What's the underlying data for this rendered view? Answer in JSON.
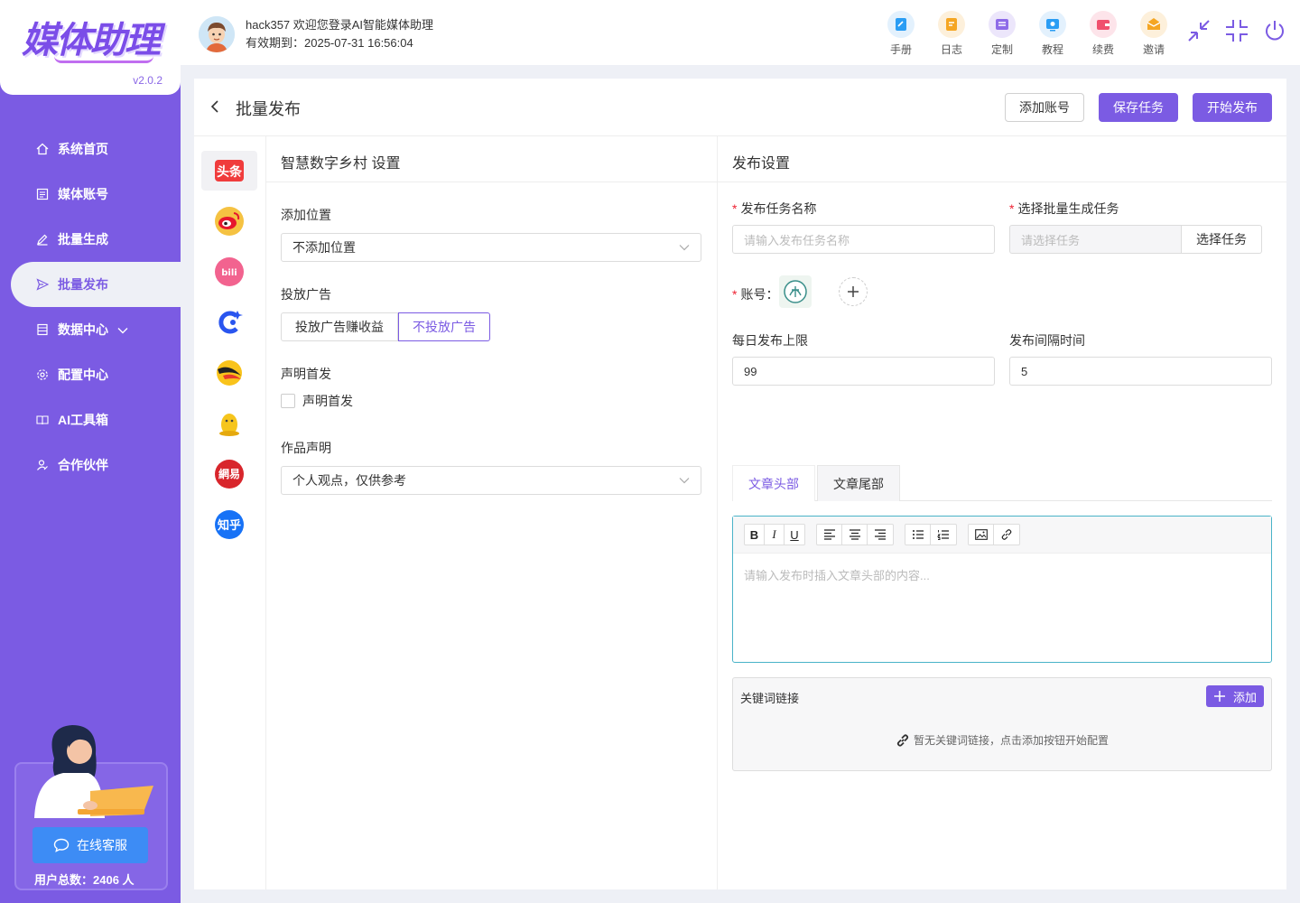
{
  "app": {
    "logo_text": "媒体助理",
    "version": "v2.0.2"
  },
  "sidebar": {
    "items": [
      {
        "label": "系统首页",
        "icon": "home-icon"
      },
      {
        "label": "媒体账号",
        "icon": "list-icon"
      },
      {
        "label": "批量生成",
        "icon": "edit-icon"
      },
      {
        "label": "批量发布",
        "icon": "send-icon",
        "active": true
      },
      {
        "label": "数据中心",
        "icon": "database-icon",
        "expandable": true
      },
      {
        "label": "配置中心",
        "icon": "gear-icon"
      },
      {
        "label": "AI工具箱",
        "icon": "book-icon"
      },
      {
        "label": "合作伙伴",
        "icon": "partner-icon"
      }
    ],
    "support_label": "在线客服",
    "user_count_label": "用户总数：2406 人"
  },
  "header": {
    "welcome": "hack357 欢迎您登录AI智能媒体助理",
    "expiry": "有效期到：2025-07-31 16:56:04",
    "tools": [
      {
        "label": "手册",
        "color": "#2a9df4"
      },
      {
        "label": "日志",
        "color": "#f5a623"
      },
      {
        "label": "定制",
        "color": "#8e6be8"
      },
      {
        "label": "教程",
        "color": "#2a9df4"
      },
      {
        "label": "续费",
        "color": "#f0506e"
      },
      {
        "label": "邀请",
        "color": "#f5a623"
      }
    ]
  },
  "page": {
    "title": "批量发布",
    "add_account_label": "添加账号",
    "save_task_label": "保存任务",
    "start_publish_label": "开始发布"
  },
  "platforms": [
    "头条",
    "微博",
    "bilibili",
    "百家号",
    "搜狐号",
    "企鹅号",
    "网易号",
    "知乎"
  ],
  "settings": {
    "heading": "智慧数字乡村 设置",
    "location_label": "添加位置",
    "location_value": "不添加位置",
    "ad_label": "投放广告",
    "ad_option_1": "投放广告赚收益",
    "ad_option_2": "不投放广告",
    "original_label": "声明首发",
    "original_checkbox": "声明首发",
    "statement_label": "作品声明",
    "statement_value": "个人观点，仅供参考"
  },
  "publish": {
    "heading": "发布设置",
    "task_name_label": "发布任务名称",
    "task_name_placeholder": "请输入发布任务名称",
    "batch_task_label": "选择批量生成任务",
    "batch_task_placeholder": "请选择任务",
    "select_task_button": "选择任务",
    "account_label": "账号：",
    "daily_limit_label": "每日发布上限",
    "daily_limit_value": "99",
    "interval_label": "发布间隔时间",
    "interval_value": "5",
    "tab_header": "文章头部",
    "tab_footer": "文章尾部",
    "editor_placeholder": "请输入发布时插入文章头部的内容...",
    "keyword_title": "关键词链接",
    "keyword_add": "添加",
    "keyword_empty": "暂无关键词链接，点击添加按钮开始配置"
  }
}
